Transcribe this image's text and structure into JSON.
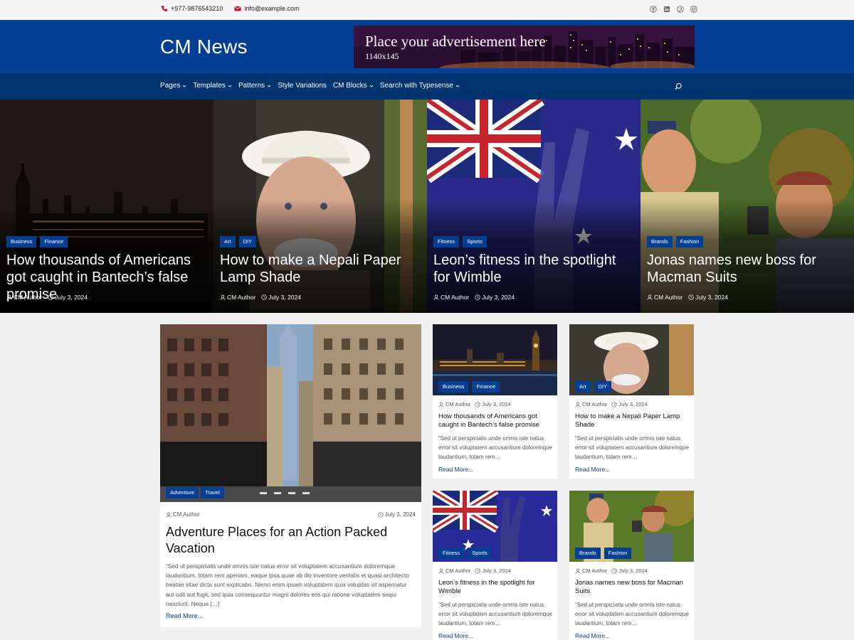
{
  "topbar": {
    "phone": "+977-9876543210",
    "email": "info@example.com",
    "social": [
      "facebook-icon",
      "linkedin-icon",
      "pinterest-icon",
      "instagram-icon"
    ]
  },
  "header": {
    "site_title": "CM News",
    "ad": {
      "title": "Place your advertisement here",
      "size": "1140x145"
    }
  },
  "nav": {
    "items": [
      {
        "label": "Pages",
        "has_dropdown": true
      },
      {
        "label": "Templates",
        "has_dropdown": true
      },
      {
        "label": "Patterns",
        "has_dropdown": true
      },
      {
        "label": "Style Variations",
        "has_dropdown": false
      },
      {
        "label": "CM Blocks",
        "has_dropdown": true
      },
      {
        "label": "Search with Typesense",
        "has_dropdown": true
      }
    ]
  },
  "hero": [
    {
      "cats": [
        "Business",
        "Finance"
      ],
      "title": "How thousands of Americans got caught in Bantech’s false promise",
      "author": "CM Author",
      "date": "July 3, 2024"
    },
    {
      "cats": [
        "Art",
        "DIY"
      ],
      "title": "How to make a Nepali Paper Lamp Shade",
      "author": "CM Author",
      "date": "July 3, 2024"
    },
    {
      "cats": [
        "Fitness",
        "Sports"
      ],
      "title": "Leon’s fitness in the spotlight for Wimble",
      "author": "CM Author",
      "date": "July 3, 2024"
    },
    {
      "cats": [
        "Brands",
        "Fashion"
      ],
      "title": "Jonas names new boss for Macman Suits",
      "author": "CM Author",
      "date": "July 3, 2024"
    }
  ],
  "featured": {
    "cats": [
      "Adventure",
      "Travel"
    ],
    "author": "CM Author",
    "date": "July 3, 2024",
    "title": "Adventure Places for an Action Packed Vacation",
    "excerpt": "“Sed ut perspiciatis unde omnis iste natus error sit voluptatem accusantium doloremque laudantium, totam rem aperiam, eaque ipsa quae ab illo inventore veritatis et quasi architecto beatae vitae dicta sunt explicabo. Nemo enim ipsam voluptatem quia voluptas sit aspernatur aut odit aut fugit, sed quia consequuntur magni dolores eos qui ratione voluptatem sequi nesciunt. Neque […]",
    "read_more": "Read More..."
  },
  "grid": [
    {
      "cats": [
        "Business",
        "Finance"
      ],
      "author": "CM Author",
      "date": "July 3, 2024",
      "title": "How thousands of Americans got caught in Bantech’s false promise",
      "excerpt": "“Sed ut perspiciatis unde omnis iste natus error sit voluptatem accusantium doloremque laudantium, totam rem…",
      "read_more": "Read More..."
    },
    {
      "cats": [
        "Art",
        "DIY"
      ],
      "author": "CM Author",
      "date": "July 3, 2024",
      "title": "How to make a Nepali Paper Lamp Shade",
      "excerpt": "“Sed ut perspiciatis unde omnis iste natus error sit voluptatem accusantium doloremque laudantium, totam rem…",
      "read_more": "Read More..."
    },
    {
      "cats": [
        "Fitness",
        "Sports"
      ],
      "author": "CM Author",
      "date": "July 3, 2024",
      "title": "Leon’s fitness in the spotlight for Wimble",
      "excerpt": "“Sed ut perspiciatis unde omnis iste natus error sit voluptatem accusantium doloremque laudantium, totam rem…",
      "read_more": "Read More..."
    },
    {
      "cats": [
        "Brands",
        "Fashion"
      ],
      "author": "CM Author",
      "date": "July 3, 2024",
      "title": "Jonas names new boss for Macman Suits",
      "excerpt": "“Sed ut perspiciatis unde omnis iste natus error sit voluptatem accusantium doloremque laudantium, totam rem…",
      "read_more": "Read More..."
    }
  ],
  "colors": {
    "header_bg": "#053f94",
    "nav_bg": "#00346f",
    "category_badge": "#053f94",
    "link": "#053f94"
  }
}
